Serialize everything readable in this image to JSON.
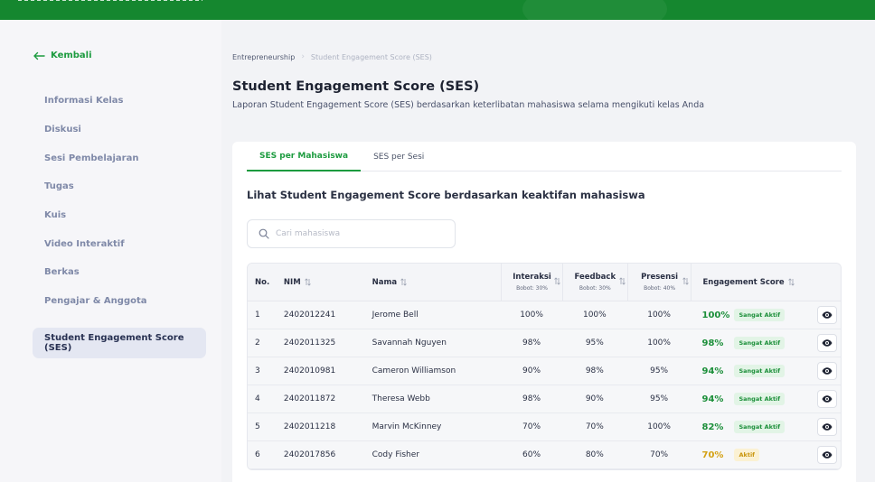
{
  "colors": {
    "brand": "#15872f",
    "accent": "#1c9b3f",
    "score_high": "#1c8f3a",
    "score_mid": "#d4a114"
  },
  "sidebar": {
    "back_label": "Kembali",
    "items": [
      {
        "label": "Informasi Kelas"
      },
      {
        "label": "Diskusi"
      },
      {
        "label": "Sesi Pembelajaran"
      },
      {
        "label": "Tugas"
      },
      {
        "label": "Kuis"
      },
      {
        "label": "Video Interaktif"
      },
      {
        "label": "Berkas"
      },
      {
        "label": "Pengajar & Anggota"
      },
      {
        "label": "Student Engagement Score (SES)",
        "active": true
      }
    ]
  },
  "breadcrumb": {
    "parent": "Entrepreneurship",
    "current": "Student Engagement Score (SES)"
  },
  "page": {
    "title": "Student Engagement Score (SES)",
    "subtitle": "Laporan Student Engagement Score (SES) berdasarkan keterlibatan mahasiswa selama mengikuti kelas Anda"
  },
  "tabs": [
    {
      "label": "SES per Mahasiswa",
      "active": true
    },
    {
      "label": "SES per Sesi",
      "active": false
    }
  ],
  "section_heading": "Lihat Student Engagement Score berdasarkan keaktifan mahasiswa",
  "search": {
    "placeholder": "Cari mahasiswa",
    "value": "",
    "icon": "search-icon"
  },
  "table": {
    "headers": {
      "no": "No.",
      "nim": "NIM",
      "nama": "Nama",
      "interaksi": "Interaksi",
      "interaksi_weight": "Bobot: 30%",
      "feedback": "Feedback",
      "feedback_weight": "Bobot: 30%",
      "presensi": "Presensi",
      "presensi_weight": "Bobot: 40%",
      "score": "Engagement Score"
    },
    "rows": [
      {
        "no": "1",
        "nim": "2402012241",
        "nama": "Jerome Bell",
        "interaksi": "100%",
        "feedback": "100%",
        "presensi": "100%",
        "score": "100%",
        "status": "Sangat Aktif",
        "level": "high"
      },
      {
        "no": "2",
        "nim": "2402011325",
        "nama": "Savannah Nguyen",
        "interaksi": "98%",
        "feedback": "95%",
        "presensi": "100%",
        "score": "98%",
        "status": "Sangat Aktif",
        "level": "high"
      },
      {
        "no": "3",
        "nim": "2402010981",
        "nama": "Cameron Williamson",
        "interaksi": "90%",
        "feedback": "98%",
        "presensi": "95%",
        "score": "94%",
        "status": "Sangat Aktif",
        "level": "high"
      },
      {
        "no": "4",
        "nim": "2402011872",
        "nama": "Theresa Webb",
        "interaksi": "98%",
        "feedback": "90%",
        "presensi": "95%",
        "score": "94%",
        "status": "Sangat Aktif",
        "level": "high"
      },
      {
        "no": "5",
        "nim": "2402011218",
        "nama": "Marvin McKinney",
        "interaksi": "70%",
        "feedback": "70%",
        "presensi": "100%",
        "score": "82%",
        "status": "Sangat Aktif",
        "level": "high"
      },
      {
        "no": "6",
        "nim": "2402017856",
        "nama": "Cody Fisher",
        "interaksi": "60%",
        "feedback": "80%",
        "presensi": "70%",
        "score": "70%",
        "status": "Aktif",
        "level": "mid"
      }
    ]
  }
}
